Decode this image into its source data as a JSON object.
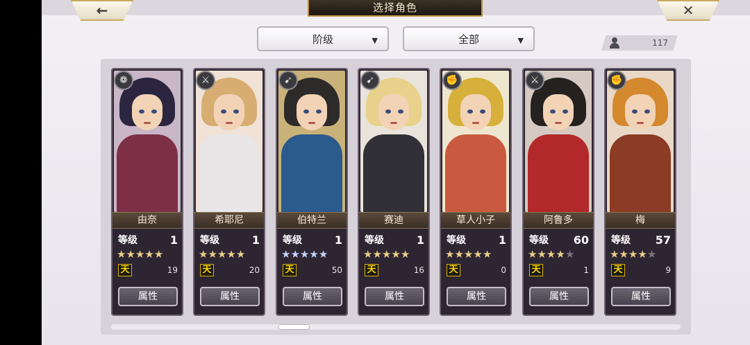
{
  "screen_title": "选择角色",
  "nav": {
    "back_glyph": "←",
    "close_glyph": "✕"
  },
  "filters": {
    "rank_label": "阶级",
    "category_label": "全部",
    "arrow": "▼"
  },
  "count": "117",
  "level_label": "等级",
  "attribute_label": "属性",
  "sky_glyph": "天",
  "characters": [
    {
      "name": "由奈",
      "level": "1",
      "stars": 5,
      "star_color": "gold",
      "sky": "19",
      "class_glyph": "❁",
      "hair": "#2b2540",
      "body": "#7c2f45",
      "bg": "#c9b6c6"
    },
    {
      "name": "希耶尼",
      "level": "1",
      "stars": 5,
      "star_color": "gold",
      "sky": "20",
      "class_glyph": "⚔",
      "hair": "#d7ad72",
      "body": "#e9e6e8",
      "bg": "#f0e2d6"
    },
    {
      "name": "伯特兰",
      "level": "1",
      "stars": 5,
      "star_color": "blue",
      "sky": "50",
      "class_glyph": "➹",
      "hair": "#2d2a2a",
      "body": "#2b5a8c",
      "bg": "#c9b27a"
    },
    {
      "name": "赛迪",
      "level": "1",
      "stars": 5,
      "star_color": "gold",
      "sky": "16",
      "class_glyph": "➹",
      "hair": "#e8d18a",
      "body": "#303036",
      "bg": "#e8e4dc"
    },
    {
      "name": "草人小子",
      "level": "1",
      "stars": 5,
      "star_color": "gold",
      "sky": "0",
      "class_glyph": "✊",
      "hair": "#d7b03c",
      "body": "#c95a3f",
      "bg": "#efe6cf"
    },
    {
      "name": "阿鲁多",
      "level": "60",
      "stars": 4,
      "star_color": "gold",
      "sky": "1",
      "class_glyph": "⚔",
      "hair": "#24211f",
      "body": "#b3282a",
      "bg": "#d6c9c2"
    },
    {
      "name": "梅",
      "level": "57",
      "stars": 4,
      "star_color": "gold",
      "sky": "9",
      "class_glyph": "✊",
      "hair": "#d4892f",
      "body": "#8c3b24",
      "bg": "#e9d8c6"
    }
  ]
}
